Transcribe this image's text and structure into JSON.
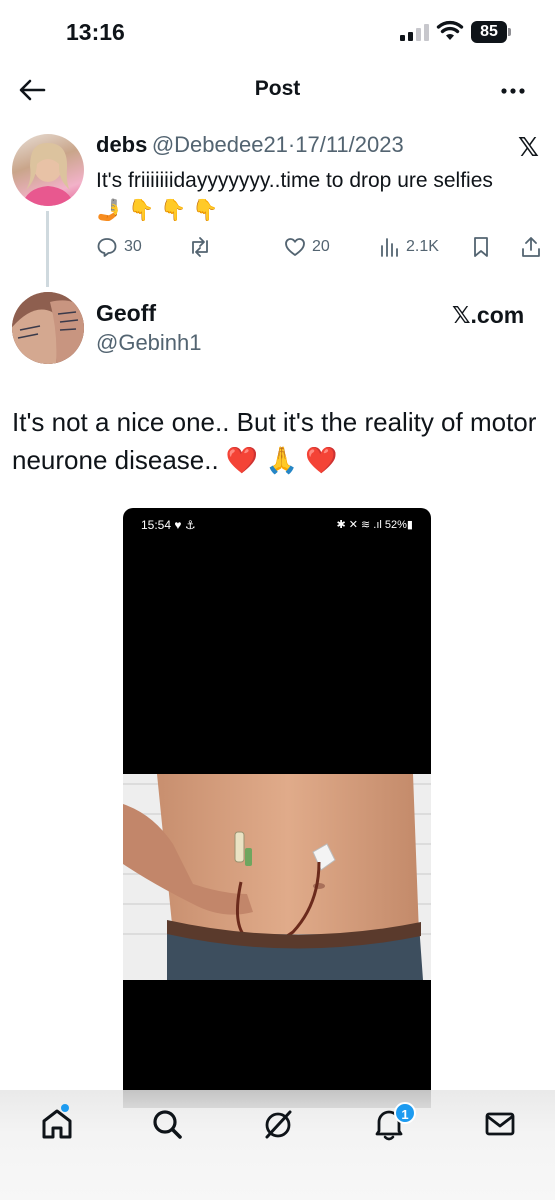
{
  "status_bar": {
    "time": "13:16",
    "battery": "85"
  },
  "topbar": {
    "title": "Post"
  },
  "quoted_post": {
    "display_name": "debs",
    "handle": "@Debedee21",
    "date": "17/11/2023",
    "text": "It's friiiiiiidayyyyyyy..time to drop ure selfies 🤳 👇 👇 👇",
    "replies": "30",
    "likes": "20",
    "views": "2.1K"
  },
  "main_post": {
    "display_name": "Geoff",
    "handle": "@Gebinh1",
    "watermark": "𝕏.com",
    "text": "It's not a nice one.. But it's the reality of motor neurone disease.. ❤️ 🙏 ❤️"
  },
  "embedded_screenshot": {
    "time": "15:54 ♥ ⚓",
    "status": "✱ ✕ ≋ .ıl 52%▮"
  },
  "tabbar": {
    "notifications_count": "1"
  }
}
